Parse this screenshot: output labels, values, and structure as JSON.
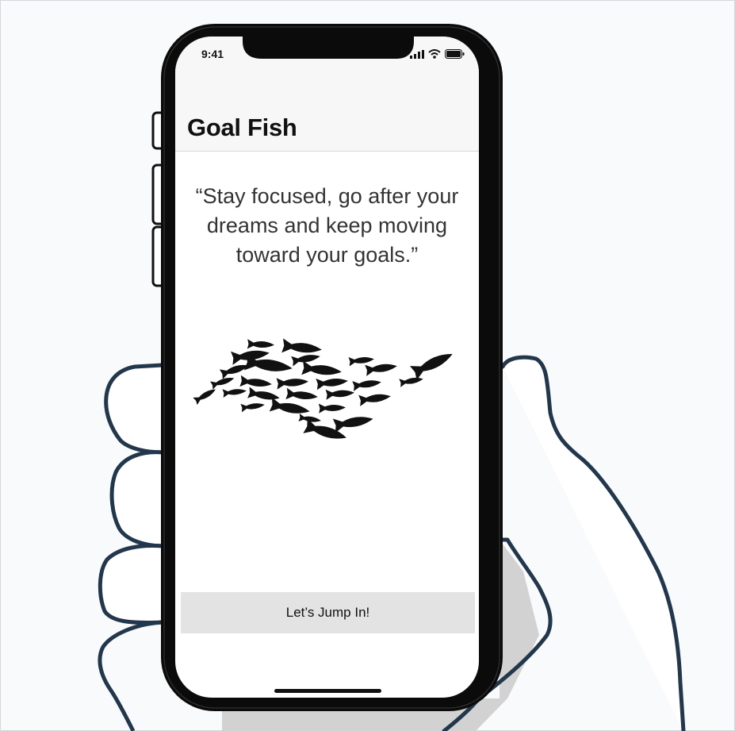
{
  "status_bar": {
    "time": "9:41",
    "icons": [
      "signal-icon",
      "wifi-icon",
      "battery-icon"
    ]
  },
  "nav": {
    "title": "Goal Fish"
  },
  "main": {
    "quote": "“Stay focused, go after your dreams and keep moving toward your goals.”",
    "illustration": "fish-school-illustration",
    "button_label": "Let’s Jump In!"
  },
  "colors": {
    "hand_outline": "#22374c",
    "phone_body": "#0b0b0b",
    "button_bg": "#e3e3e3",
    "nav_bg": "#f7f7f7"
  }
}
